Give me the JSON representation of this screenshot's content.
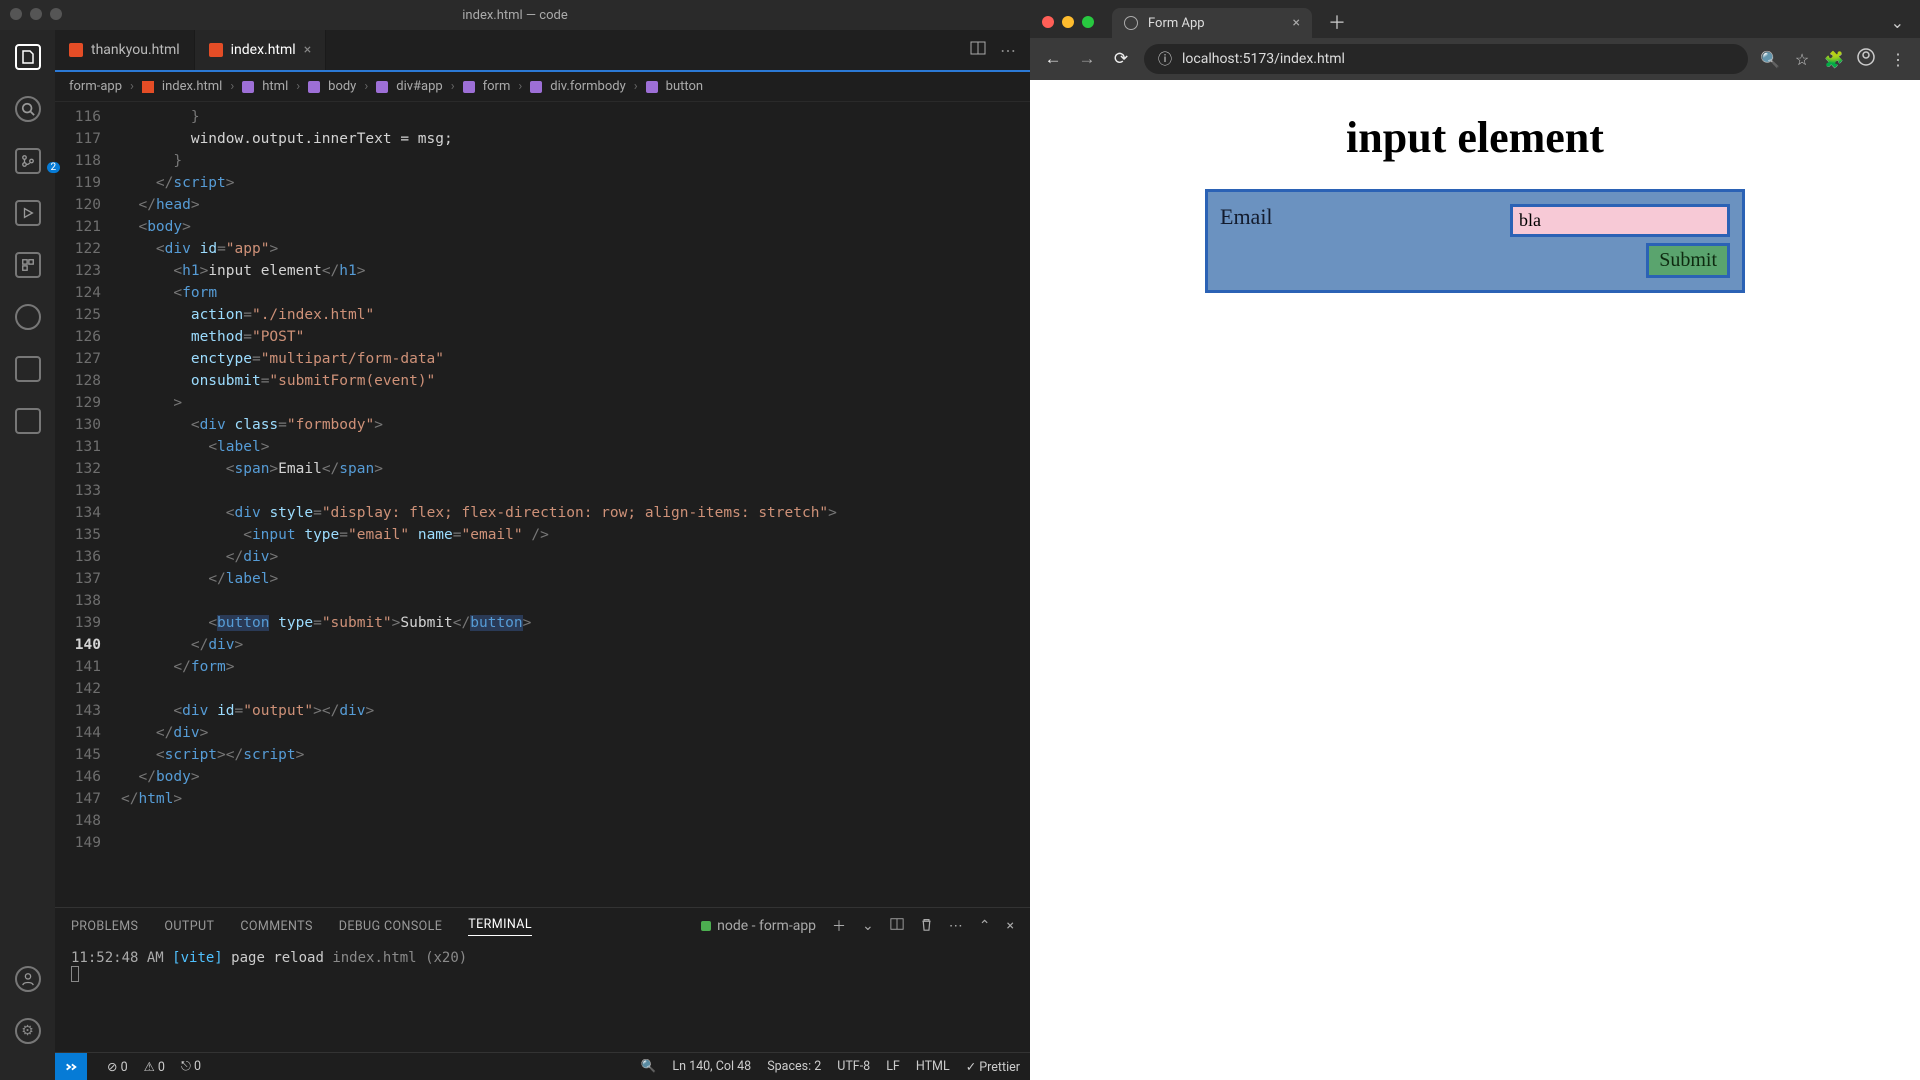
{
  "vscode": {
    "title": "index.html — code",
    "tabs": [
      {
        "name": "thankyou.html",
        "active": false
      },
      {
        "name": "index.html",
        "active": true
      }
    ],
    "breadcrumbs": [
      "form-app",
      "index.html",
      "html",
      "body",
      "div#app",
      "form",
      "div.formbody",
      "button"
    ],
    "activity_badge_scm": "2",
    "gutter_start": 116,
    "gutter_lines": [
      "116",
      "117",
      "118",
      "119",
      "120",
      "121",
      "122",
      "123",
      "124",
      "125",
      "126",
      "127",
      "128",
      "129",
      "130",
      "131",
      "132",
      "133",
      "134",
      "135",
      "136",
      "137",
      "138",
      "139",
      "140",
      "141",
      "142",
      "143",
      "144",
      "145",
      "146",
      "147",
      "148",
      "149"
    ],
    "current_line": "140",
    "panel": {
      "tabs": [
        "PROBLEMS",
        "OUTPUT",
        "COMMENTS",
        "DEBUG CONSOLE",
        "TERMINAL"
      ],
      "active": "TERMINAL",
      "task_label": "node - form-app",
      "line_time": "11:52:48 AM",
      "line_tag": "[vite]",
      "line_msg": "page reload",
      "line_file": "index.html",
      "line_count": "(x20)"
    },
    "status": {
      "errors": "0",
      "warnings": "0",
      "ports": "0",
      "cursor": "Ln 140, Col 48",
      "spaces": "Spaces: 2",
      "encoding": "UTF-8",
      "eol": "LF",
      "lang": "HTML",
      "formatter": "Prettier"
    }
  },
  "code": {
    "l117": "        window.output.innerText = msg;",
    "l118": "      }",
    "l119_tag": "script",
    "l120_tag": "head",
    "l121_tag": "body",
    "div": "div",
    "id": "id",
    "app": "\"app\"",
    "h1": "h1",
    "h1_text": "input element",
    "form": "form",
    "action": "action",
    "action_v": "\"./index.html\"",
    "method": "method",
    "method_v": "\"POST\"",
    "enctype": "enctype",
    "enctype_v": "\"multipart/form-data\"",
    "onsubmit": "onsubmit",
    "onsubmit_v": "\"submitForm(event)\"",
    "class": "class",
    "formbody": "\"formbody\"",
    "label": "label",
    "span": "span",
    "span_text": "Email",
    "style": "style",
    "style_v": "\"display: flex; flex-direction: row; align-items: stretch\"",
    "input": "input",
    "type": "type",
    "email_t": "\"email\"",
    "name": "name",
    "email_n": "\"email\"",
    "button": "button",
    "submit_t": "\"submit\"",
    "submit_text": "Submit",
    "output": "\"output\"",
    "html": "html"
  },
  "browser": {
    "tab_title": "Form App",
    "url": "localhost:5173/index.html",
    "page": {
      "heading": "input element",
      "email_label": "Email",
      "email_value": "bla",
      "submit_label": "Submit"
    }
  }
}
